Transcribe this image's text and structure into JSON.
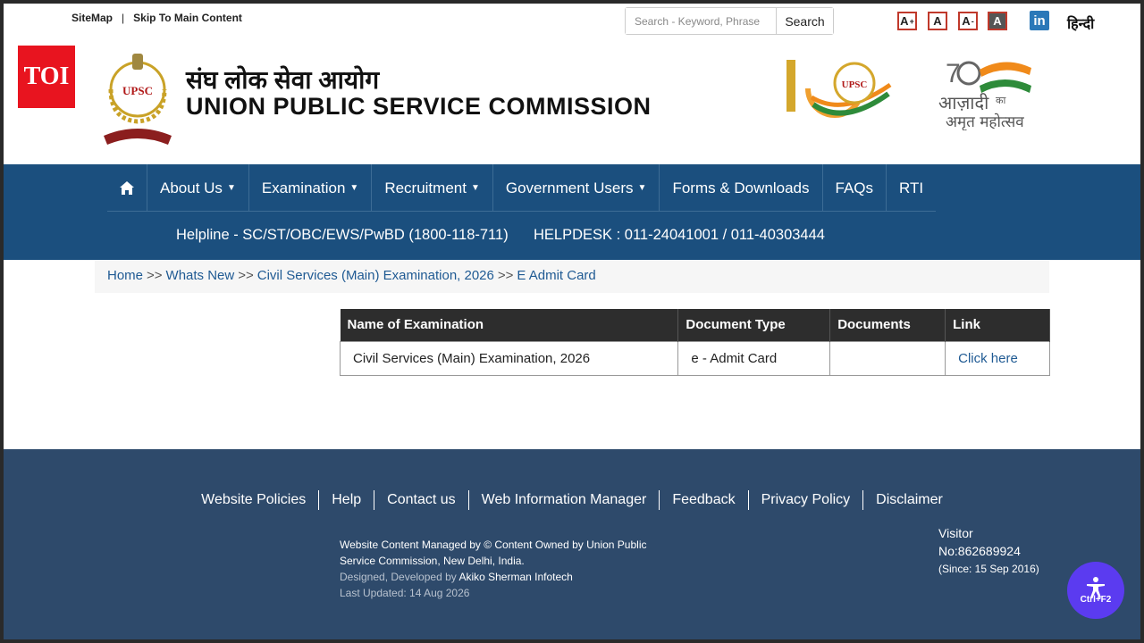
{
  "topbar": {
    "sitemap": "SiteMap",
    "separator": "|",
    "skip": "Skip To Main Content",
    "search_placeholder": "Search - Keyword, Phrase",
    "search_button": "Search",
    "font_increase": "A",
    "font_increase_sup": "+",
    "font_normal": "A",
    "font_decrease": "A",
    "font_decrease_sup": "-",
    "font_contrast": "A",
    "linkedin": "in",
    "hindi": "हिन्दी"
  },
  "header": {
    "toi": "TOI",
    "title_hindi": "संघ लोक सेवा आयोग",
    "title_english": "UNION PUBLIC SERVICE COMMISSION",
    "emblem_text": "UPSC",
    "logo100_text": "UPSC",
    "logo75_hindi": "आज़ादी",
    "logo75_small": "का",
    "logo75_line2": "अमृत महोत्सव"
  },
  "nav": {
    "items": [
      {
        "label": "About Us",
        "dropdown": true
      },
      {
        "label": "Examination",
        "dropdown": true
      },
      {
        "label": "Recruitment",
        "dropdown": true
      },
      {
        "label": "Government Users",
        "dropdown": true
      },
      {
        "label": "Forms & Downloads",
        "dropdown": false
      },
      {
        "label": "FAQs",
        "dropdown": false
      },
      {
        "label": "RTI",
        "dropdown": false
      }
    ],
    "helpline": "Helpline - SC/ST/OBC/EWS/PwBD (1800-118-711)",
    "helpdesk": "HELPDESK : 011-24041001 / 011-40303444"
  },
  "breadcrumb": {
    "items": [
      "Home",
      "Whats New",
      "Civil Services (Main) Examination, 2026",
      "E Admit Card"
    ],
    "separator": ">>"
  },
  "table": {
    "headers": [
      "Name of Examination",
      "Document Type",
      "Documents",
      "Link"
    ],
    "rows": [
      {
        "name": "Civil Services (Main) Examination, 2026",
        "type": "e - Admit Card",
        "documents": "",
        "link": "Click here"
      }
    ]
  },
  "footer": {
    "links": [
      "Website Policies",
      "Help",
      "Contact us",
      "Web Information Manager",
      "Feedback",
      "Privacy Policy",
      "Disclaimer"
    ],
    "managed": "Website Content Managed by © Content Owned by Union Public Service Commission, New Delhi, India.",
    "designed_prefix": "Designed, Developed by",
    "designed_by": "Akiko Sherman Infotech",
    "last_updated": "Last Updated: 14 Aug 2026",
    "visitor_label": "Visitor",
    "visitor_no": "No:862689924",
    "since": "(Since: 15 Sep 2016)"
  },
  "a11y": {
    "shortcut": "Ctrl+F2"
  },
  "colors": {
    "nav_bg": "#1b4f7e",
    "footer_bg": "#2e4a6b",
    "link": "#1f5a93",
    "toi_red": "#e8141f",
    "a11y_purple": "#5b3bf0"
  }
}
